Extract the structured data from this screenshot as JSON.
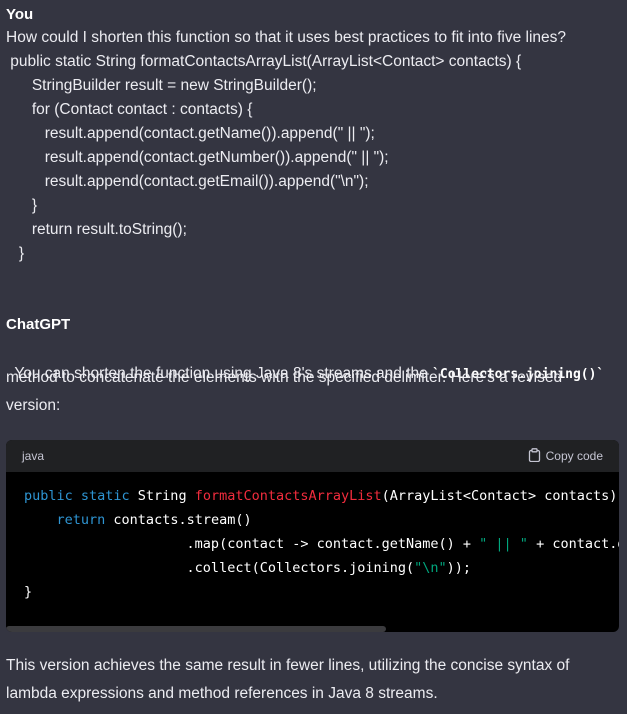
{
  "user": {
    "author": "You",
    "question": "How could I shorten this function so that it uses best practices to fit into five lines?",
    "code_lines": [
      " public static String formatContactsArrayList(ArrayList<Contact> contacts) {",
      "      StringBuilder result = new StringBuilder();",
      "      for (Contact contact : contacts) {",
      "         result.append(contact.getName()).append(\" || \");",
      "         result.append(contact.getNumber()).append(\" || \");",
      "         result.append(contact.getEmail()).append(\"\\n\");",
      "      }",
      "      return result.toString();",
      "   }"
    ]
  },
  "assistant": {
    "author": "ChatGPT",
    "intro_before": "You can shorten the function using Java 8's streams and the ",
    "inline_code": "`Collectors.joining()`",
    "intro_line2": "method to concatenate the elements with the specified delimiter. Here's a revised",
    "intro_line3": "version:",
    "code": {
      "language": "java",
      "copy_label": "Copy code",
      "l1_kw": "public static",
      "l1_type": " String ",
      "l1_fn": "formatContactsArrayList",
      "l1_rest": "(ArrayList<Contact> contacts) {",
      "l2_indent": "    ",
      "l2_kw": "return",
      "l2_rest": " contacts.stream()",
      "l3_pre": "                    .map(contact -> contact.getName() + ",
      "l3_str": "\" || \"",
      "l3_post": " + contact.getNumber() + ",
      "l4_pre": "                    .collect(Collectors.joining(",
      "l4_str": "\"\\n\"",
      "l4_post": "));",
      "l5": "}"
    },
    "outro_line1": "This version achieves the same result in fewer lines, utilizing the concise syntax of",
    "outro_line2": "lambda expressions and method references in Java 8 streams."
  }
}
